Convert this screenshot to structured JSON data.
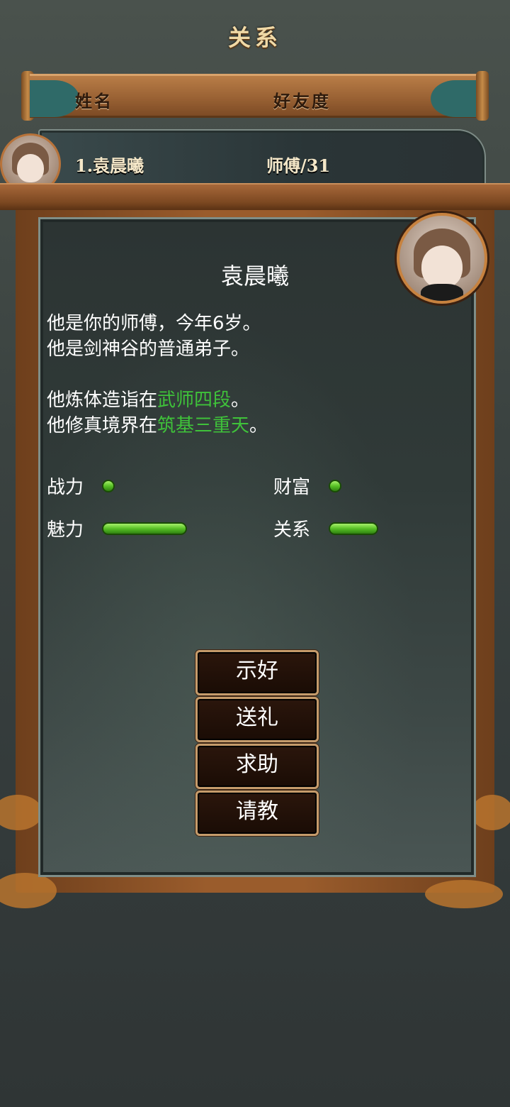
{
  "header": {
    "title": "关系"
  },
  "columns": {
    "name": "姓名",
    "friendship": "好友度"
  },
  "list": [
    {
      "label": "1.袁晨曦",
      "relation": "师傅/31"
    }
  ],
  "detail": {
    "name": "袁晨曦",
    "line1": "他是你的师傅，今年6岁。",
    "line2": "他是剑神谷的普通弟子。",
    "line3_prefix": "他炼体造诣在",
    "line3_value": "武师四段",
    "line3_suffix": "。",
    "line4_prefix": "他修真境界在",
    "line4_value": "筑基三重天",
    "line4_suffix": "。",
    "stats": {
      "combat_label": "战力",
      "combat_level": 0.05,
      "wealth_label": "财富",
      "wealth_level": 0.05,
      "charm_label": "魅力",
      "charm_level": 0.6,
      "relation_label": "关系",
      "relation_level": 0.35
    },
    "actions": [
      "示好",
      "送礼",
      "求助",
      "请教"
    ]
  },
  "colors": {
    "highlight": "#3fc23a",
    "bar": "#57c025",
    "wood": "#9a5c2c"
  }
}
